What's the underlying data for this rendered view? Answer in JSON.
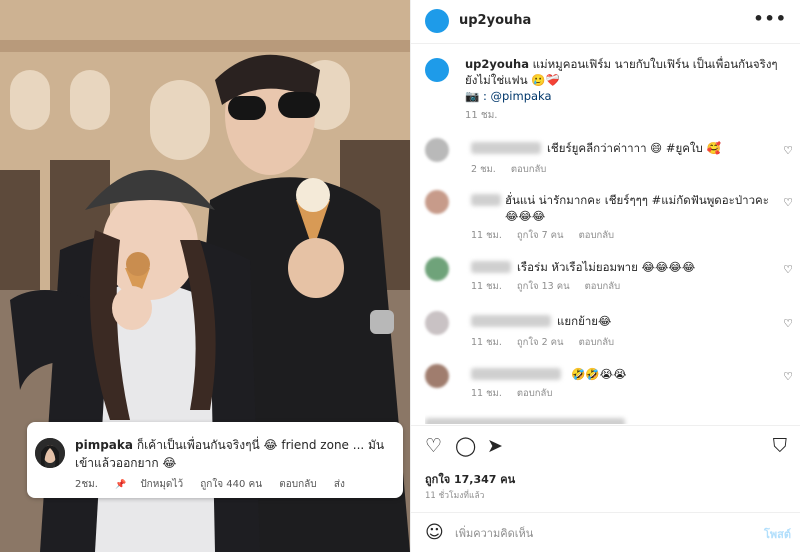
{
  "post": {
    "username": "up2youha",
    "caption_user": "up2youha",
    "caption_text": "แม่หมูคอนเฟิร์ม นายกับใบเฟิร์น เป็นเพื่อนกันจริงๆ ยังไม่ใช่แฟน 🥲❤️‍🩹",
    "caption_credit": "📷 : @pimpaka",
    "caption_time": "11 ชม.",
    "likes": "ถูกใจ 17,347 คน",
    "posted_ago": "11 ชั่วโมงที่แล้ว",
    "comment_placeholder": "เพิ่มความคิดเห็น",
    "post_label": "โพสต์",
    "more_label": "•••"
  },
  "comments": [
    {
      "text": "เชียร์ยูคลีกว่าค่าาาา 😄 #ยูคใบ 🥰",
      "time": "2 ชม.",
      "likes": "",
      "reply": "ตอบกลับ",
      "avatar_color": "#b9b9b9"
    },
    {
      "text": "ฮั่นแน่ น่ารักมากคะ เชียร์ๆๆๆ #แม่กัดฟันพูดอะป่าวคะ 😂😂😂",
      "time": "11 ชม.",
      "likes": "ถูกใจ 7 คน",
      "reply": "ตอบกลับ",
      "avatar_color": "#c79b8a"
    },
    {
      "text": "เรือร่ม หัวเรือไม่ยอมพาย 😂😂😂😂",
      "time": "11 ชม.",
      "likes": "ถูกใจ 13 คน",
      "reply": "ตอบกลับ",
      "avatar_color": "#6fa37a"
    },
    {
      "text": "แยกย้าย😂",
      "time": "11 ชม.",
      "likes": "ถูกใจ 2 คน",
      "reply": "ตอบกลับ",
      "avatar_color": "#c9c2c4"
    },
    {
      "text": "🤣🤣😭😭",
      "time": "11 ชม.",
      "likes": "",
      "reply": "ตอบกลับ",
      "avatar_color": "#a07d6e"
    }
  ],
  "overlay_comment": {
    "username": "pimpaka",
    "text": "ก็เค้าเป็นเพื่อนกันจริงๆนี่ 😂 friend zone ... มันเข้าแล้วออกยาก 😂",
    "time": "2ชม.",
    "pin": "ปักหมุดไว้",
    "likes": "ถูกใจ 440 คน",
    "reply": "ตอบกลับ",
    "send": "ส่ง"
  },
  "icons": {
    "heart": "♡",
    "comment": "◯",
    "share": "➤",
    "bookmark": "⛉",
    "emoji": "☺",
    "pin": "📌"
  },
  "colors": {
    "accent": "#1e9be9",
    "muted": "#8e8e8e",
    "post_disabled": "#b2dffc"
  }
}
